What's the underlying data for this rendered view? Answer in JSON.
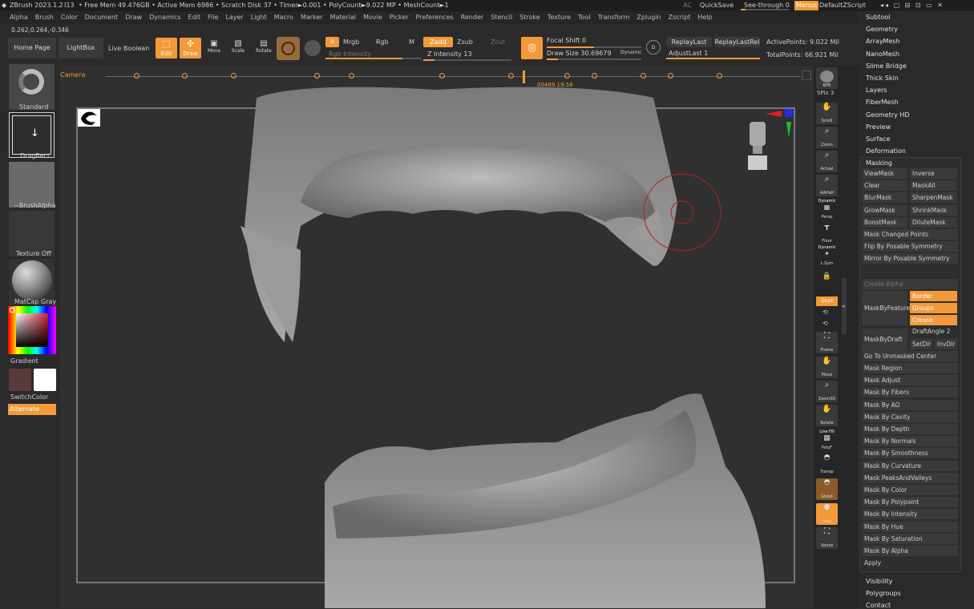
{
  "titlebar": {
    "app": "ZBrush 2023.1.2",
    "doc": "I13",
    "stats": "• Free Mem 49.476GB • Active Mem 6986 • Scratch Disk 37 • Timer►0.001 • PolyCount►9.022 MP • MeshCount►1",
    "ac": "AC",
    "quicksave": "QuickSave",
    "seethrough": "See-through 0",
    "menus": "Menus",
    "script": "DefaultZScript"
  },
  "menubar": [
    "Alpha",
    "Brush",
    "Color",
    "Document",
    "Draw",
    "Dynamics",
    "Edit",
    "File",
    "Layer",
    "Light",
    "Macro",
    "Marker",
    "Material",
    "Movie",
    "Picker",
    "Preferences",
    "Render",
    "Stencil",
    "Stroke",
    "Texture",
    "Tool",
    "Transform",
    "Zplugin",
    "Zscript",
    "Help"
  ],
  "coords": "0.262,0.264,-0.346",
  "toolbar": {
    "home": "Home Page",
    "lightbox": "LightBox",
    "liveboolean": "Live Boolean",
    "edit": "Edit",
    "draw": "Draw",
    "move": "Move",
    "scale": "Scale",
    "rotate": "Rotate",
    "a": "A",
    "mrgb": "Mrgb",
    "rgb": "Rgb",
    "m": "M",
    "zadd": "Zadd",
    "zsub": "Zsub",
    "zcut": "Zcut",
    "rgbintensity": "Rgb Intensity",
    "zintensity": "Z Intensity 13",
    "focalshift": "Focal Shift 0",
    "drawsize": "Draw Size 30.69679",
    "dynamic": "Dynamic",
    "replaylast": "ReplayLast",
    "replaylastrel": "ReplayLastRel",
    "adjustlast": "AdjustLast 1",
    "activepoints": "ActivePoints: 9.022 Mil",
    "totalpoints": "TotalPoints: 66.921 Mil",
    "camera": "Camera",
    "timeline_time": "00469 19:58"
  },
  "levels": {
    "rgb_intensity": 0.8,
    "z_intensity": 0.13,
    "focal_shift": 0.5,
    "draw_size": 0.12,
    "adjust_last": 1.0,
    "see_through": 0.0,
    "timeline_pos": 0.6
  },
  "leftshelf": {
    "standard": "Standard",
    "dragrect": "DragRect",
    "brushalpha": "~BrushAlpha",
    "textureoff": "Texture Off",
    "matcap": "MatCap Gray",
    "gradient": "Gradient",
    "switchcolor": "SwitchColor",
    "alternate": "Alternate"
  },
  "rightshelf": {
    "bpr": "BPR",
    "spix": "SPix 3",
    "scroll": "Scroll",
    "zoom": "Zoom",
    "actual": "Actual",
    "aahalf": "AAHalf",
    "dynamic": "Dynamic",
    "persp": "Persp",
    "floor": "Floor",
    "dynamic2": "Dynamic",
    "lsym": "L.Sym",
    "xyz": "Qxyz",
    "frame": "Frame",
    "move": "Move",
    "zoom3d": "Zoom3D",
    "rotate": "Rotate",
    "linefill": "Line Fill",
    "polyf": "PolyF",
    "transp": "Transp",
    "ghost": "Ghost",
    "solo": "Solo",
    "xpose": "Xpose"
  },
  "panel": {
    "top": [
      "Subtool",
      "Geometry",
      "ArrayMesh",
      "NanoMesh",
      "Slime Bridge",
      "Thick Skin",
      "Layers",
      "FiberMesh",
      "Geometry HD",
      "Preview",
      "Surface",
      "Deformation"
    ],
    "masking": "Masking",
    "grid": [
      [
        "ViewMask",
        "Inverse"
      ],
      [
        "Clear",
        "MaskAll"
      ],
      [
        "BlurMask",
        "SharpenMask"
      ],
      [
        "GrowMask",
        "ShrinkMask"
      ],
      [
        "BoostMask",
        "DiluteMask"
      ]
    ],
    "wide1": [
      "Mask Changed Points",
      "Flip By Posable Symmetry",
      "Mirror By Posable Symmetry"
    ],
    "createalpha": "Create Alpha",
    "maskbyfeature": "MaskByFeature",
    "border": "Border",
    "groups": "Groups",
    "crease": "Crease",
    "maskbydraft": "MaskByDraft",
    "draftangle": "DraftAngle 2",
    "setdir": "SetDir",
    "invdir": "InvDir",
    "list": [
      "Go To Unmasked Center",
      "Mask Region",
      "Mask Adjust",
      "Mask By Fibers",
      "Mask By AO",
      "Mask By Cavity",
      "Mask By Depth",
      "Mask By Normals",
      "Mask By Smoothness",
      "Mask By Curvature",
      "Mask PeaksAndValleys",
      "Mask By Color",
      "Mask By Polypaint",
      "Mask By Intensity",
      "Mask By Hue",
      "Mask By Saturation",
      "Mask By Alpha",
      "Apply"
    ],
    "bottom": [
      "Visibility",
      "Polygroups",
      "Contact"
    ]
  },
  "colors": {
    "accent": "#f29a3a",
    "panel": "#2a2a2a",
    "button": "#3a3a3a"
  }
}
